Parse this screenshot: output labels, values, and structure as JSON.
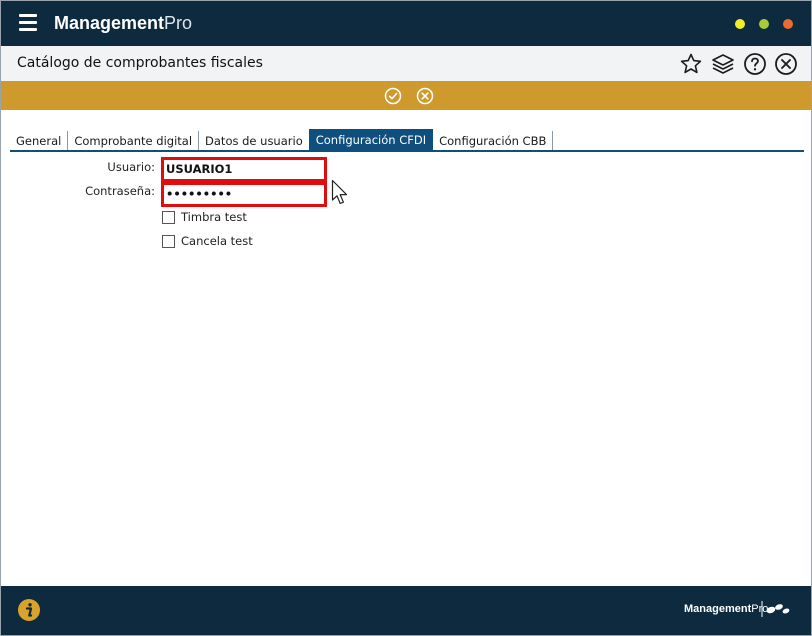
{
  "app": {
    "title_bold": "Management",
    "title_light": "Pro"
  },
  "header": {
    "page_title": "Catálogo de comprobantes fiscales"
  },
  "icons": {
    "menu": "hamburger-icon",
    "favorite": "star-icon",
    "layers": "layers-icon",
    "help": "help-icon",
    "close": "close-circle-icon",
    "confirm": "check-circle-icon",
    "cancel": "cancel-circle-icon",
    "info": "info-icon"
  },
  "colors": {
    "titlebar": "#0d2a3e",
    "action_bar": "#cf9a2d",
    "active_tab": "#0f4f7e",
    "highlight": "#e00d0d",
    "window_min": "#f2ef2a",
    "window_max": "#a7c93a",
    "window_close": "#ef6a2f"
  },
  "tabs": [
    {
      "label": "General",
      "active": false
    },
    {
      "label": "Comprobante digital",
      "active": false
    },
    {
      "label": "Datos de usuario",
      "active": false
    },
    {
      "label": "Configuración CFDI",
      "active": true
    },
    {
      "label": "Configuración CBB",
      "active": false
    }
  ],
  "form": {
    "usuario_label": "Usuario:",
    "usuario_value": "USUARIO1",
    "password_label": "Contraseña:",
    "password_value": "•••••••••",
    "timbra_test_label": "Timbra test",
    "timbra_test_checked": false,
    "cancela_test_label": "Cancela test",
    "cancela_test_checked": false
  },
  "footer": {
    "logo_bold": "Management",
    "logo_light": "Pro"
  }
}
